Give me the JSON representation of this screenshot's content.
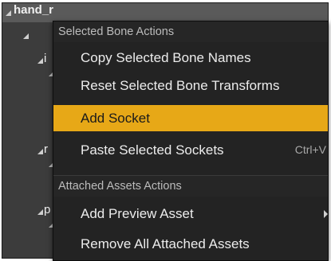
{
  "tree": {
    "root_label": "hand_r",
    "child_glyphs": [
      "i",
      "r",
      "p"
    ]
  },
  "menu": {
    "sections": [
      {
        "header": "Selected Bone Actions",
        "items": [
          {
            "label": "Copy Selected Bone Names"
          },
          {
            "label": "Reset Selected Bone Transforms"
          },
          {
            "label": "Add Socket"
          },
          {
            "label": "Paste Selected Sockets",
            "shortcut": "Ctrl+V"
          }
        ]
      },
      {
        "header": "Attached Assets Actions",
        "items": [
          {
            "label": "Add Preview Asset"
          },
          {
            "label": "Remove All Attached Assets"
          }
        ]
      }
    ]
  },
  "colors": {
    "menu_background": "#232323",
    "highlight": "#e7a817",
    "panel_background": "#3c3c3c"
  }
}
